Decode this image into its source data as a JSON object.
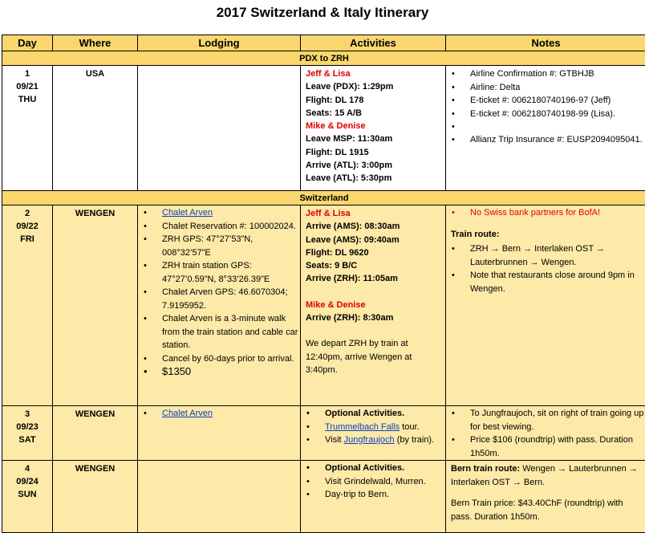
{
  "title": "2017 Switzerland & Italy Itinerary",
  "headers": [
    "Day",
    "Where",
    "Lodging",
    "Activities",
    "Notes"
  ],
  "sections": {
    "pdx": "PDX to ZRH",
    "switzerland": "Switzerland"
  },
  "rows": [
    {
      "day": "1",
      "date": "09/21",
      "dow": "THU",
      "where": "USA",
      "activities": {
        "jeff": "Jeff & Lisa",
        "jeff_lines": [
          "Leave (PDX): 1:29pm",
          "Flight: DL 178",
          "Seats: 15 A/B"
        ],
        "mike": "Mike & Denise",
        "mike_lines": [
          "Leave MSP: 11:30am",
          "Flight: DL 1915",
          "Arrive (ATL): 3:00pm",
          "Leave (ATL): 5:30pm"
        ]
      },
      "notes": [
        "Airline Confirmation #: GTBHJB",
        "Airline: Delta",
        "E-ticket #:  0062180740196-97 (Jeff)",
        "E-ticket #: 0062180740198-99 (Lisa).",
        "Allianz Trip Insurance #: EUSP2094095041."
      ]
    },
    {
      "day": "2",
      "date": "09/22",
      "dow": "FRI",
      "where": "WENGEN",
      "lodging": [
        "Chalet Arven",
        "Chalet Reservation #: 100002024.",
        "ZRH GPS: 47°27’53”N, 008°32’57”E",
        "ZRH train station GPS: 47°27’0.59”N, 8°33’26.39”E",
        "Chalet Arven GPS: 46.6070304; 7.9195952.",
        "Chalet Arven is a 3-minute walk from the train station and cable car station.",
        "Cancel by 60-days prior to arrival.",
        "$1350"
      ],
      "activities": {
        "jeff": "Jeff & Lisa",
        "jeff_lines": [
          "Arrive (AMS): 08:30am",
          "Leave (AMS): 09:40am",
          "Flight: DL 9620",
          "Seats: 9 B/C",
          "Arrive (ZRH): 11:05am"
        ],
        "mike": "Mike & Denise",
        "mike_lines": [
          "Arrive (ZRH): 8:30am"
        ],
        "extra": "We depart ZRH by train at 12:40pm, arrive Wengen at 3:40pm."
      },
      "notes": {
        "alert": "No Swiss bank partners for BofA!",
        "train_title": "Train route:",
        "train_items": [
          "ZRH → Bern → Interlaken OST → Lauterbrunnen → Wengen.",
          "Note that restaurants close around 9pm in Wengen."
        ]
      }
    },
    {
      "day": "3",
      "date": "09/23",
      "dow": "SAT",
      "where": "WENGEN",
      "lodging": [
        "Chalet Arven"
      ],
      "activities": [
        "Optional Activities.",
        "Trummelbach Falls tour.",
        "Visit Jungfraujoch (by train)."
      ],
      "notes": [
        "To Jungfraujoch, sit on right of train going up for best viewing.",
        "Price $106 (roundtrip) with pass. Duration 1h50m."
      ]
    },
    {
      "day": "4",
      "date": "09/24",
      "dow": "SUN",
      "where": "WENGEN",
      "activities": [
        "Optional Activities.",
        "Visit Grindelwald, Murren.",
        "Day-trip to Bern."
      ],
      "notes": {
        "route_title": "Bern train route:",
        "route": "Wengen → Lauterbrunnen → Interlaken OST → Bern.",
        "price": "Bern Train price: $43.40ChF (roundtrip) with pass. Duration 1h50m."
      }
    }
  ]
}
